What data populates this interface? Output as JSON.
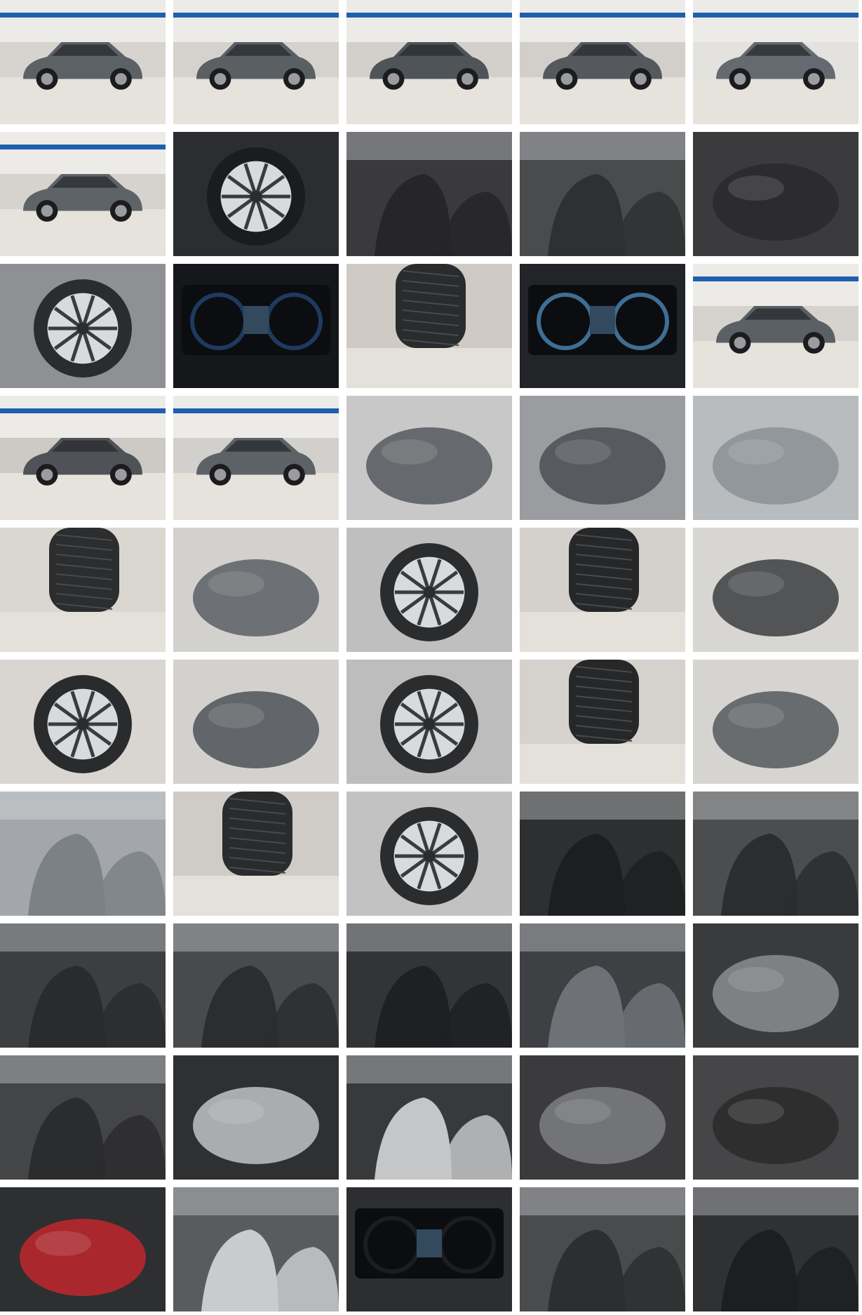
{
  "gallery": {
    "columns": 5,
    "rows": 10,
    "tiles": [
      {
        "scene": "car-front-left-showroom",
        "bg": "#d7d4cf",
        "obj": "#5c6166"
      },
      {
        "scene": "car-front-right-showroom",
        "bg": "#d5d2cd",
        "obj": "#5a5f64"
      },
      {
        "scene": "car-rear-left",
        "bg": "#d3d0cb",
        "obj": "#4f5459"
      },
      {
        "scene": "car-rear-right",
        "bg": "#d2cfca",
        "obj": "#55595e"
      },
      {
        "scene": "car-side",
        "bg": "#e3e2df",
        "obj": "#646a70"
      },
      {
        "scene": "car-front-three-quarter",
        "bg": "#d6d3ce",
        "obj": "#5e6368"
      },
      {
        "scene": "steering-wheel",
        "bg": "#2b2d30",
        "obj": "#1b1c1e"
      },
      {
        "scene": "rear-seats",
        "bg": "#3a3a3c",
        "obj": "#262628"
      },
      {
        "scene": "front-seats-door-open",
        "bg": "#4a4b4d",
        "obj": "#2f3032"
      },
      {
        "scene": "trunk",
        "bg": "#3b3b3d",
        "obj": "#2a2a2c"
      },
      {
        "scene": "front-wheel",
        "bg": "#8e9094",
        "obj": "#2b2c2e"
      },
      {
        "scene": "instrument-cluster",
        "bg": "#15171a",
        "obj": "#1e3a5f"
      },
      {
        "scene": "tire-closeup",
        "bg": "#cfcac4",
        "obj": "#2a2b2d"
      },
      {
        "scene": "infotainment-camera",
        "bg": "#222427",
        "obj": "#3f6e94"
      },
      {
        "scene": "car-front-showroom",
        "bg": "#d6d3cf",
        "obj": "#5b6065"
      },
      {
        "scene": "car-rear-showroom",
        "bg": "#cdcac5",
        "obj": "#4f5358"
      },
      {
        "scene": "car-front-grille",
        "bg": "#d2d0cc",
        "obj": "#5d6267"
      },
      {
        "scene": "front-bumper-closeup",
        "bg": "#c8c8c8",
        "obj": "#55595e"
      },
      {
        "scene": "rear-bumper-closeup",
        "bg": "#9a9ca0",
        "obj": "#4b4f54"
      },
      {
        "scene": "windshield-closeup",
        "bg": "#b9bcbf",
        "obj": "#8a9094"
      },
      {
        "scene": "tire-floor-view",
        "bg": "#dad6d0",
        "obj": "#2c2d2f"
      },
      {
        "scene": "side-skirt-view",
        "bg": "#d3d1cd",
        "obj": "#5a5f64"
      },
      {
        "scene": "rear-wheel",
        "bg": "#bfbfc0",
        "obj": "#2b2c2e"
      },
      {
        "scene": "tire-tread",
        "bg": "#d4d0cb",
        "obj": "#262729"
      },
      {
        "scene": "underbody-rear",
        "bg": "#d8d6d3",
        "obj": "#3c3d3f"
      },
      {
        "scene": "wheel-arch-front",
        "bg": "#d9d6d1",
        "obj": "#2a2b2d"
      },
      {
        "scene": "hood-front-view",
        "bg": "#d3d1cd",
        "obj": "#4e5257"
      },
      {
        "scene": "wheel-side",
        "bg": "#bdbdbe",
        "obj": "#2b2c2e"
      },
      {
        "scene": "tire-tread-rear",
        "bg": "#d5d1cc",
        "obj": "#262729"
      },
      {
        "scene": "underbody-side",
        "bg": "#d6d4d0",
        "obj": "#55595e"
      },
      {
        "scene": "door-panel-exterior",
        "bg": "#a3a6aa",
        "obj": "#7c8186"
      },
      {
        "scene": "tire-sidewall",
        "bg": "#cfccc7",
        "obj": "#2a2b2d"
      },
      {
        "scene": "wheel-front-right",
        "bg": "#c2c2c3",
        "obj": "#2b2c2e"
      },
      {
        "scene": "dashboard-passenger-side",
        "bg": "#2e2f31",
        "obj": "#1d1e20"
      },
      {
        "scene": "front-seat-driver-view",
        "bg": "#4c4d4f",
        "obj": "#2c2d2f"
      },
      {
        "scene": "front-seat-closeup",
        "bg": "#3d3e40",
        "obj": "#2a2b2d"
      },
      {
        "scene": "seats-door-open",
        "bg": "#494a4c",
        "obj": "#2c2d2f"
      },
      {
        "scene": "door-interior-panel",
        "bg": "#333436",
        "obj": "#1f2022"
      },
      {
        "scene": "door-speaker-closeup",
        "bg": "#3f4043",
        "obj": "#6e7276"
      },
      {
        "scene": "panoramic-sunroof",
        "bg": "#3a3b3d",
        "obj": "#8b8e91"
      },
      {
        "scene": "rear-seat-row",
        "bg": "#444547",
        "obj": "#2b2c2e"
      },
      {
        "scene": "sunroof-headliner",
        "bg": "#2f3032",
        "obj": "#bfc2c4"
      },
      {
        "scene": "rear-door-panel",
        "bg": "#38393b",
        "obj": "#c4c6c8"
      },
      {
        "scene": "trunk-floor-cables",
        "bg": "#3b3b3d",
        "obj": "#7d7f82"
      },
      {
        "scene": "charging-cable-bag",
        "bg": "#464648",
        "obj": "#2a2a2c"
      },
      {
        "scene": "trunk-button-closeup",
        "bg": "#2e2f31",
        "obj": "#c0272d"
      },
      {
        "scene": "front-door-panel",
        "bg": "#5a5b5e",
        "obj": "#c9cbcd"
      },
      {
        "scene": "dashboard-center",
        "bg": "#2d2e30",
        "obj": "#1c1d1f"
      },
      {
        "scene": "front-seats-open-door",
        "bg": "#4a4b4d",
        "obj": "#2d2e30"
      },
      {
        "scene": "dashboard-driver-side",
        "bg": "#303133",
        "obj": "#1d1e20"
      }
    ]
  }
}
